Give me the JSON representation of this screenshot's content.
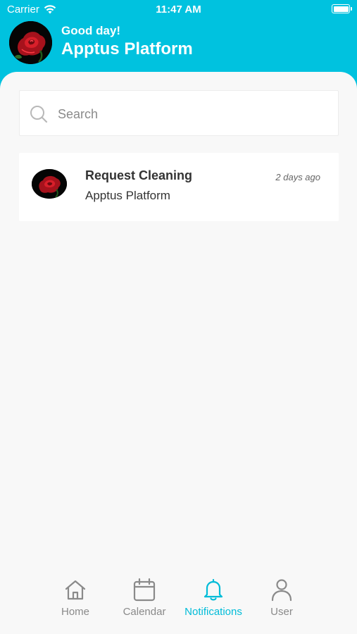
{
  "status_bar": {
    "carrier": "Carrier",
    "time": "11:47 AM",
    "wifi_icon": "wifi-icon",
    "battery_icon": "battery-icon"
  },
  "header": {
    "greeting": "Good day!",
    "title": "Apptus Platform",
    "avatar": "rose-avatar"
  },
  "search": {
    "placeholder": "Search",
    "value": "",
    "icon": "search-icon"
  },
  "notifications": [
    {
      "title": "Request Cleaning",
      "subtitle": "Apptus Platform",
      "time": "2 days ago",
      "avatar": "rose-avatar"
    }
  ],
  "tabs": [
    {
      "label": "Home",
      "icon": "home-icon",
      "active": false
    },
    {
      "label": "Calendar",
      "icon": "calendar-icon",
      "active": false
    },
    {
      "label": "Notifications",
      "icon": "bell-icon",
      "active": true
    },
    {
      "label": "User",
      "icon": "user-icon",
      "active": false
    }
  ],
  "colors": {
    "brand": "#00c2df",
    "active_tab": "#00bcd8",
    "inactive_tab": "#8a8a8a",
    "background": "#f8f8f8"
  }
}
